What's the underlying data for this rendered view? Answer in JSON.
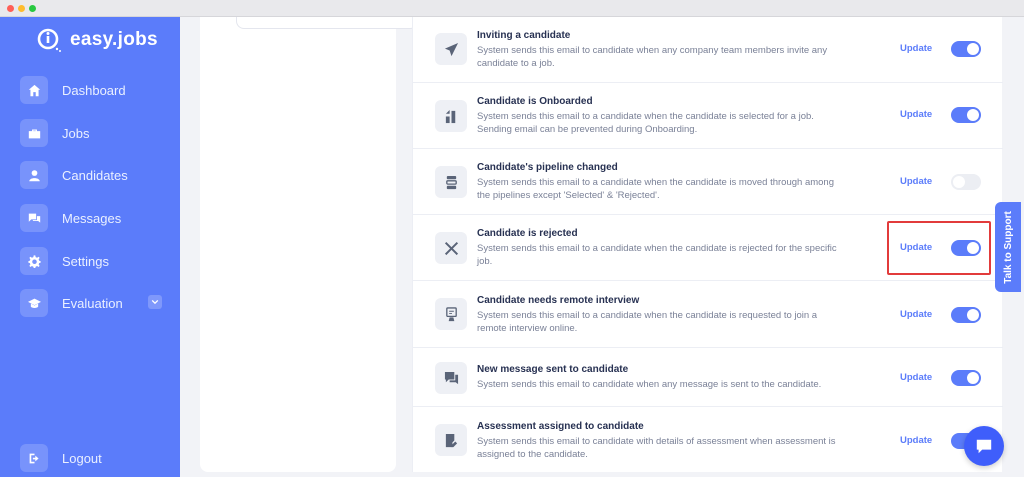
{
  "app": {
    "logo_text": "easy.jobs"
  },
  "sidebar": {
    "items": [
      {
        "label": "Dashboard"
      },
      {
        "label": "Jobs"
      },
      {
        "label": "Candidates"
      },
      {
        "label": "Messages"
      },
      {
        "label": "Settings"
      },
      {
        "label": "Evaluation"
      }
    ],
    "logout": "Logout"
  },
  "notifications": [
    {
      "title": "Inviting a candidate",
      "desc": "System sends this email to candidate when any company team members invite any candidate to a job.",
      "update": "Update",
      "enabled": true
    },
    {
      "title": "Candidate is Onboarded",
      "desc": "System sends this email to a candidate when the candidate is selected for a job. Sending email can be prevented during Onboarding.",
      "update": "Update",
      "enabled": true
    },
    {
      "title": "Candidate's pipeline changed",
      "desc": "System sends this email to a candidate when the candidate is moved through among the pipelines except 'Selected' & 'Rejected'.",
      "update": "Update",
      "enabled": false
    },
    {
      "title": "Candidate is rejected",
      "desc": "System sends this email to a candidate when the candidate is rejected for the specific job.",
      "update": "Update",
      "enabled": true
    },
    {
      "title": "Candidate needs remote interview",
      "desc": "System sends this email to a candidate when the candidate is requested to join a remote interview online.",
      "update": "Update",
      "enabled": true
    },
    {
      "title": "New message sent to candidate",
      "desc": "System sends this email to candidate when any message is sent to the candidate.",
      "update": "Update",
      "enabled": true
    },
    {
      "title": "Assessment assigned to candidate",
      "desc": "System sends this email to candidate with details of assessment when assessment is assigned to the candidate.",
      "update": "Update",
      "enabled": true
    }
  ],
  "support": {
    "label": "Talk to Support"
  },
  "colors": {
    "accent": "#5b7cfa",
    "highlight": "#e23b3b"
  }
}
